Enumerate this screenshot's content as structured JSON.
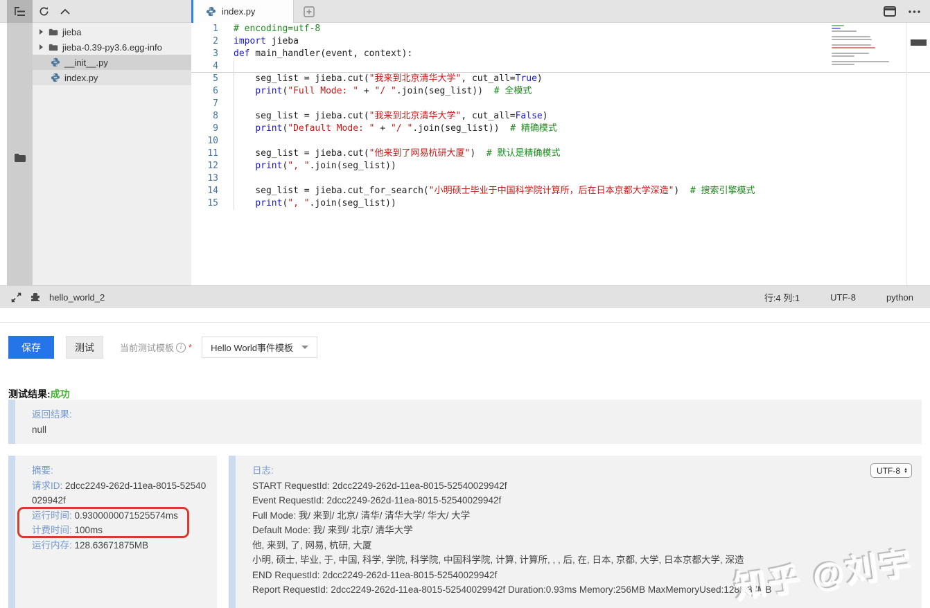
{
  "editor": {
    "tabs": [
      {
        "label": "index.py",
        "active": true
      }
    ],
    "files": [
      {
        "label": "jieba",
        "type": "folder"
      },
      {
        "label": "jieba-0.39-py3.6.egg-info",
        "type": "folder"
      },
      {
        "label": "__init__.py",
        "type": "python",
        "state": "sel"
      },
      {
        "label": "index.py",
        "type": "python",
        "state": "open"
      }
    ],
    "code": [
      {
        "n": 1,
        "segs": [
          {
            "t": "# encoding=utf-8",
            "c": "cm"
          }
        ]
      },
      {
        "n": 2,
        "segs": [
          {
            "t": "import",
            "c": "kw"
          },
          {
            "t": " jieba",
            "c": "pl"
          }
        ]
      },
      {
        "n": 3,
        "segs": [
          {
            "t": "def",
            "c": "kw"
          },
          {
            "t": " main_handler(event, context):",
            "c": "pl"
          }
        ]
      },
      {
        "n": 4,
        "segs": []
      },
      {
        "n": 5,
        "segs": [
          {
            "t": "    seg_list = jieba.cut(",
            "c": "pl"
          },
          {
            "t": "\"我来到北京清华大学\"",
            "c": "str"
          },
          {
            "t": ", cut_all=",
            "c": "pl"
          },
          {
            "t": "True",
            "c": "kw"
          },
          {
            "t": ")",
            "c": "pl"
          }
        ]
      },
      {
        "n": 6,
        "segs": [
          {
            "t": "    ",
            "c": "pl"
          },
          {
            "t": "print",
            "c": "kw"
          },
          {
            "t": "(",
            "c": "pl"
          },
          {
            "t": "\"Full Mode: \"",
            "c": "str"
          },
          {
            "t": " + ",
            "c": "pl"
          },
          {
            "t": "\"/ \"",
            "c": "str"
          },
          {
            "t": ".join(seg_list))  ",
            "c": "pl"
          },
          {
            "t": "# 全模式",
            "c": "cm"
          }
        ]
      },
      {
        "n": 7,
        "segs": []
      },
      {
        "n": 8,
        "segs": [
          {
            "t": "    seg_list = jieba.cut(",
            "c": "pl"
          },
          {
            "t": "\"我来到北京清华大学\"",
            "c": "str"
          },
          {
            "t": ", cut_all=",
            "c": "pl"
          },
          {
            "t": "False",
            "c": "kw"
          },
          {
            "t": ")",
            "c": "pl"
          }
        ]
      },
      {
        "n": 9,
        "segs": [
          {
            "t": "    ",
            "c": "pl"
          },
          {
            "t": "print",
            "c": "kw"
          },
          {
            "t": "(",
            "c": "pl"
          },
          {
            "t": "\"Default Mode: \"",
            "c": "str"
          },
          {
            "t": " + ",
            "c": "pl"
          },
          {
            "t": "\"/ \"",
            "c": "str"
          },
          {
            "t": ".join(seg_list))  ",
            "c": "pl"
          },
          {
            "t": "# 精确模式",
            "c": "cm"
          }
        ]
      },
      {
        "n": 10,
        "segs": []
      },
      {
        "n": 11,
        "segs": [
          {
            "t": "    seg_list = jieba.cut(",
            "c": "pl"
          },
          {
            "t": "\"他来到了网易杭研大厦\"",
            "c": "str"
          },
          {
            "t": ")  ",
            "c": "pl"
          },
          {
            "t": "# 默认是精确模式",
            "c": "cm"
          }
        ]
      },
      {
        "n": 12,
        "segs": [
          {
            "t": "    ",
            "c": "pl"
          },
          {
            "t": "print",
            "c": "kw"
          },
          {
            "t": "(",
            "c": "pl"
          },
          {
            "t": "\", \"",
            "c": "str"
          },
          {
            "t": ".join(seg_list))",
            "c": "pl"
          }
        ]
      },
      {
        "n": 13,
        "segs": []
      },
      {
        "n": 14,
        "segs": [
          {
            "t": "    seg_list = jieba.cut_for_search(",
            "c": "pl"
          },
          {
            "t": "\"小明硕士毕业于中国科学院计算所，后在日本京都大学深造\"",
            "c": "str"
          },
          {
            "t": ")  ",
            "c": "pl"
          },
          {
            "t": "# 搜索引擎模式",
            "c": "cm"
          }
        ]
      },
      {
        "n": 15,
        "segs": [
          {
            "t": "    ",
            "c": "pl"
          },
          {
            "t": "print",
            "c": "kw"
          },
          {
            "t": "(",
            "c": "pl"
          },
          {
            "t": "\", \"",
            "c": "str"
          },
          {
            "t": ".join(seg_list))",
            "c": "pl"
          }
        ]
      }
    ],
    "current_line": 4,
    "statusbar": {
      "function_name": "hello_world_2",
      "cursor_position": "行:4 列:1",
      "encoding": "UTF-8",
      "language": "python"
    }
  },
  "toolbar": {
    "save_label": "保存",
    "test_label": "测试",
    "template_label": "当前测试模板",
    "required_mark": "*",
    "template_value": "Hello World事件模板"
  },
  "result": {
    "title": "测试结果:",
    "status": "成功",
    "return_label": "返回结果:",
    "return_value": "null"
  },
  "summary": {
    "title": "摘要:",
    "rows": [
      {
        "label": "请求ID:",
        "value": "2dcc2249-262d-11ea-8015-52540029942f",
        "highlighted": false
      },
      {
        "label": "运行时间:",
        "value": "0.9300000071525574ms",
        "highlighted": true
      },
      {
        "label": "计费时间:",
        "value": "100ms",
        "highlighted": true
      },
      {
        "label": "运行内存:",
        "value": "128.63671875MB",
        "highlighted": false
      }
    ]
  },
  "log": {
    "title": "日志:",
    "encoding_select_value": "UTF-8",
    "lines": [
      "START RequestId: 2dcc2249-262d-11ea-8015-52540029942f",
      "Event RequestId: 2dcc2249-262d-11ea-8015-52540029942f",
      "Full Mode: 我/ 来到/ 北京/ 清华/ 清华大学/ 华大/ 大学",
      "Default Mode: 我/ 来到/ 北京/ 清华大学",
      "他, 来到, 了, 网易, 杭研, 大厦",
      "小明, 硕士, 毕业, 于, 中国, 科学, 学院, 科学院, 中国科学院, 计算, 计算所, , , 后, 在, 日本, 京都, 大学, 日本京都大学, 深造",
      "END RequestId: 2dcc2249-262d-11ea-8015-52540029942f",
      "Report RequestId: 2dcc2249-262d-11ea-8015-52540029942f Duration:0.93ms Memory:256MB MaxMemoryUsed:128.637MB"
    ]
  },
  "watermark": "知乎 @刘宇",
  "colors": {
    "accent_blue": "#2575e8",
    "tab_accent": "#2e86e0",
    "success_green": "#43b531",
    "annotation_red": "#d93a2e",
    "label_blue": "#7498cc",
    "keyword": "#1a1ac4",
    "string": "#c41a16",
    "comment": "#1e8a1e",
    "python_icon": "#4d7799"
  }
}
